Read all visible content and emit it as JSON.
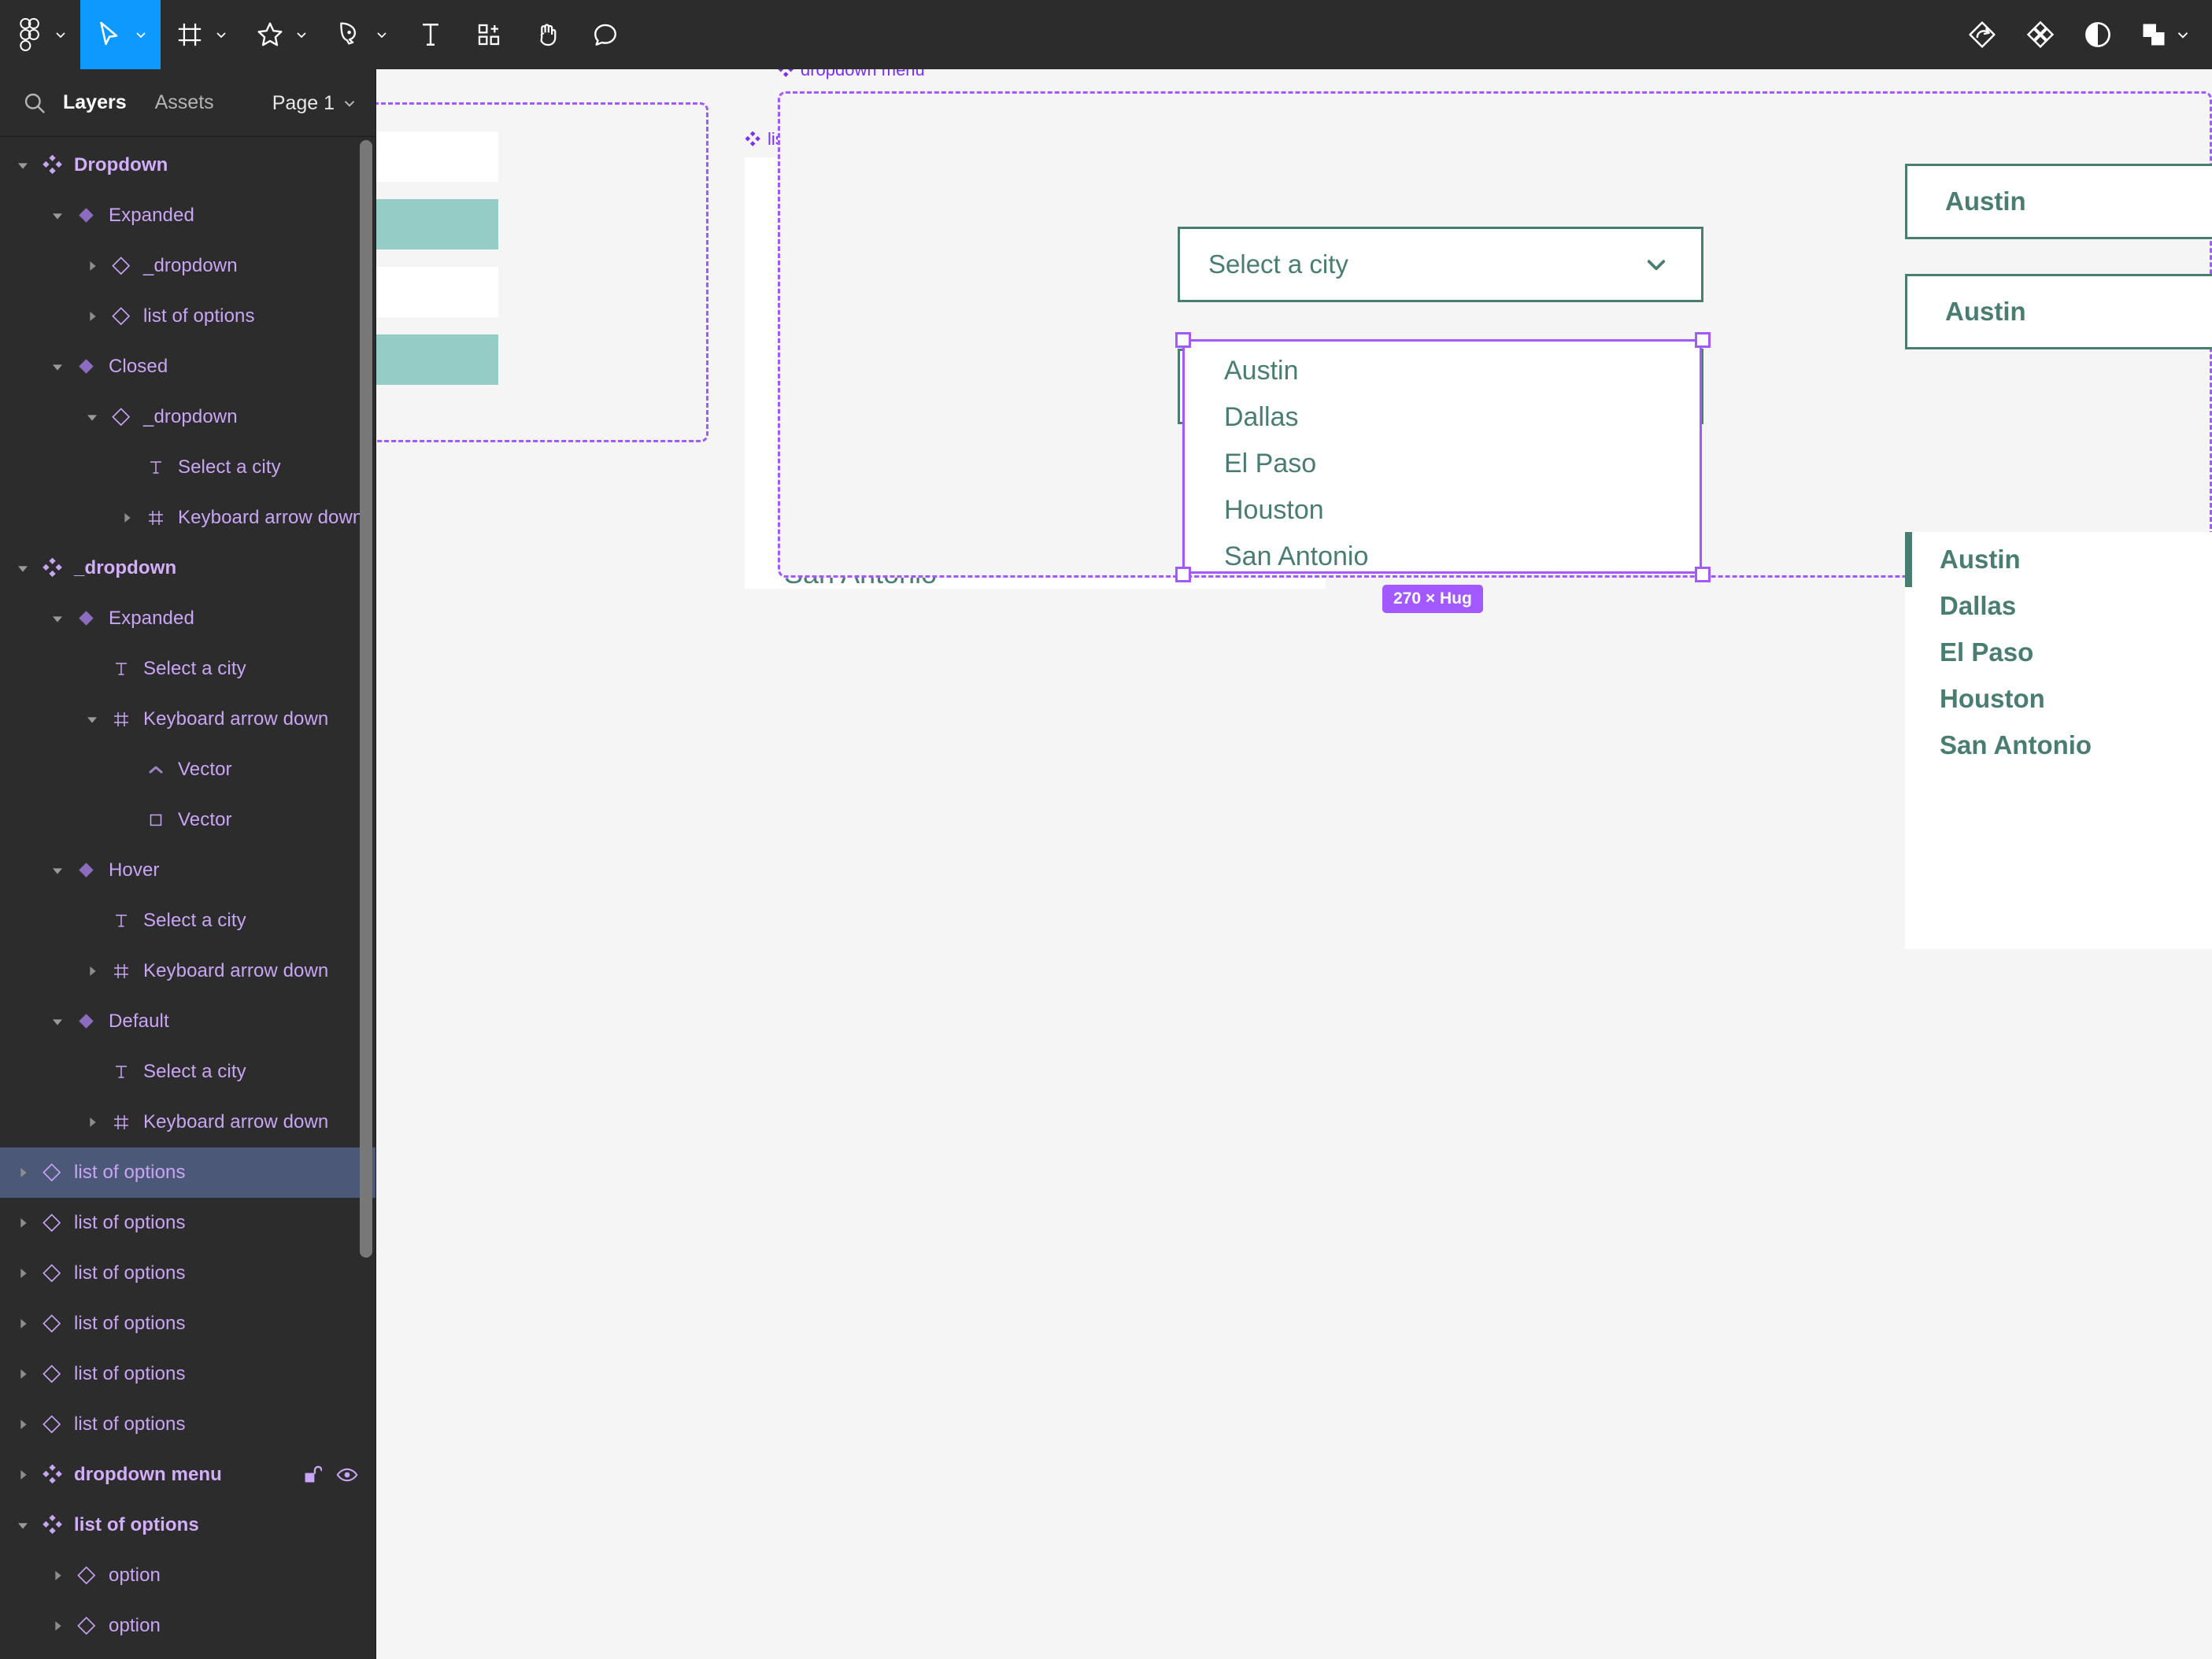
{
  "app": {
    "name": "Figma",
    "theme_dark": "#2c2c2c",
    "accent_blue": "#0d99ff",
    "accent_purple": "#a259ff",
    "brand_green": "#4a7d72",
    "brand_teal": "#95ccc6"
  },
  "toolbar": {
    "tools": [
      {
        "id": "figma-menu",
        "icon": "figma-logo-icon",
        "caret": true,
        "active": false
      },
      {
        "id": "move",
        "icon": "cursor-icon",
        "caret": true,
        "active": true
      },
      {
        "id": "frame",
        "icon": "frame-icon",
        "caret": true,
        "active": false
      },
      {
        "id": "shape",
        "icon": "star-icon",
        "caret": true,
        "active": false
      },
      {
        "id": "pen",
        "icon": "pen-icon",
        "caret": true,
        "active": false
      },
      {
        "id": "text",
        "icon": "text-icon",
        "caret": false,
        "active": false
      },
      {
        "id": "actions",
        "icon": "actions-icon",
        "caret": false,
        "active": false
      },
      {
        "id": "hand",
        "icon": "hand-icon",
        "caret": false,
        "active": false
      },
      {
        "id": "comment",
        "icon": "comment-icon",
        "caret": false,
        "active": false
      }
    ],
    "right_tools": [
      {
        "id": "dev-mode",
        "icon": "dev-mode-icon",
        "caret": false
      },
      {
        "id": "plugins",
        "icon": "plugins-icon",
        "caret": false
      },
      {
        "id": "appearance",
        "icon": "contrast-icon",
        "caret": false
      },
      {
        "id": "share",
        "icon": "layers-square-icon",
        "caret": true
      }
    ]
  },
  "left_panel": {
    "search_icon": "search-icon",
    "tabs": [
      {
        "label": "Layers",
        "selected": true
      },
      {
        "label": "Assets",
        "selected": false
      }
    ],
    "page": {
      "label": "Page 1",
      "caret_icon": "chevron-down-icon"
    },
    "layers": [
      {
        "label": "Dropdown",
        "indent": 0,
        "icon": "component-set-icon",
        "caret": "down",
        "bold": true,
        "selected": false
      },
      {
        "label": "Expanded",
        "indent": 1,
        "icon": "variant-icon",
        "caret": "down",
        "bold": false,
        "selected": false
      },
      {
        "label": "_dropdown",
        "indent": 2,
        "icon": "component-icon",
        "caret": "right",
        "bold": false,
        "selected": false
      },
      {
        "label": "list of options",
        "indent": 2,
        "icon": "component-icon",
        "caret": "right",
        "bold": false,
        "selected": false
      },
      {
        "label": "Closed",
        "indent": 1,
        "icon": "variant-icon",
        "caret": "down",
        "bold": false,
        "selected": false
      },
      {
        "label": "_dropdown",
        "indent": 2,
        "icon": "component-icon",
        "caret": "down",
        "bold": false,
        "selected": false
      },
      {
        "label": "Select a city",
        "indent": 3,
        "icon": "text-layer-icon",
        "caret": "none",
        "bold": false,
        "selected": false
      },
      {
        "label": "Keyboard arrow down",
        "indent": 3,
        "icon": "frame-layer-icon",
        "caret": "right",
        "bold": false,
        "selected": false
      },
      {
        "label": "_dropdown",
        "indent": 0,
        "icon": "component-set-icon",
        "caret": "down",
        "bold": true,
        "selected": false
      },
      {
        "label": "Expanded",
        "indent": 1,
        "icon": "variant-icon",
        "caret": "down",
        "bold": false,
        "selected": false
      },
      {
        "label": "Select a city",
        "indent": 2,
        "icon": "text-layer-icon",
        "caret": "none",
        "bold": false,
        "selected": false
      },
      {
        "label": "Keyboard arrow down",
        "indent": 2,
        "icon": "frame-layer-icon",
        "caret": "down",
        "bold": false,
        "selected": false
      },
      {
        "label": "Vector",
        "indent": 3,
        "icon": "vector-chevron-icon",
        "caret": "none",
        "bold": false,
        "selected": false
      },
      {
        "label": "Vector",
        "indent": 3,
        "icon": "vector-square-icon",
        "caret": "none",
        "bold": false,
        "selected": false
      },
      {
        "label": "Hover",
        "indent": 1,
        "icon": "variant-icon",
        "caret": "down",
        "bold": false,
        "selected": false
      },
      {
        "label": "Select a city",
        "indent": 2,
        "icon": "text-layer-icon",
        "caret": "none",
        "bold": false,
        "selected": false
      },
      {
        "label": "Keyboard arrow down",
        "indent": 2,
        "icon": "frame-layer-icon",
        "caret": "right",
        "bold": false,
        "selected": false
      },
      {
        "label": "Default",
        "indent": 1,
        "icon": "variant-icon",
        "caret": "down",
        "bold": false,
        "selected": false
      },
      {
        "label": "Select a city",
        "indent": 2,
        "icon": "text-layer-icon",
        "caret": "none",
        "bold": false,
        "selected": false
      },
      {
        "label": "Keyboard arrow down",
        "indent": 2,
        "icon": "frame-layer-icon",
        "caret": "right",
        "bold": false,
        "selected": false
      },
      {
        "label": "list of options",
        "indent": 0,
        "icon": "component-icon",
        "caret": "right",
        "bold": false,
        "selected": true
      },
      {
        "label": "list of options",
        "indent": 0,
        "icon": "component-icon",
        "caret": "right",
        "bold": false,
        "selected": false
      },
      {
        "label": "list of options",
        "indent": 0,
        "icon": "component-icon",
        "caret": "right",
        "bold": false,
        "selected": false
      },
      {
        "label": "list of options",
        "indent": 0,
        "icon": "component-icon",
        "caret": "right",
        "bold": false,
        "selected": false
      },
      {
        "label": "list of options",
        "indent": 0,
        "icon": "component-icon",
        "caret": "right",
        "bold": false,
        "selected": false
      },
      {
        "label": "list of options",
        "indent": 0,
        "icon": "component-icon",
        "caret": "right",
        "bold": false,
        "selected": false
      },
      {
        "label": "dropdown menu",
        "indent": 0,
        "icon": "component-set-icon",
        "caret": "right",
        "bold": true,
        "selected": false,
        "actions": [
          "unlock-icon",
          "eye-icon"
        ]
      },
      {
        "label": "list of options",
        "indent": 0,
        "icon": "component-set-icon",
        "caret": "down",
        "bold": true,
        "selected": false
      },
      {
        "label": "option",
        "indent": 1,
        "icon": "component-icon",
        "caret": "right",
        "bold": false,
        "selected": false
      },
      {
        "label": "option",
        "indent": 1,
        "icon": "component-icon",
        "caret": "right",
        "bold": false,
        "selected": false
      }
    ]
  },
  "canvas": {
    "frames": [
      {
        "id": "component-set-left",
        "label": "",
        "label_icon": "component-set-icon"
      },
      {
        "id": "list-of-options",
        "label": "list of options",
        "label_icon": "component-set-icon"
      },
      {
        "id": "dropdown-menu",
        "label": "dropdown menu",
        "label_icon": "component-set-icon"
      }
    ],
    "cities": [
      "Austin",
      "Dallas",
      "El Paso",
      "Houston",
      "San Antonio"
    ],
    "select_placeholder": "Select a city",
    "closed_chevron": "chevron-down-icon",
    "open_chevron": "chevron-up-icon",
    "selection": {
      "size_badge": "270 × Hug",
      "selected_node": "list of options"
    },
    "right_column": {
      "boxes": [
        "Austin",
        "Austin"
      ],
      "list": [
        "Austin",
        "Dallas",
        "El Paso",
        "Houston",
        "San Antonio"
      ],
      "highlighted": "Austin"
    }
  }
}
